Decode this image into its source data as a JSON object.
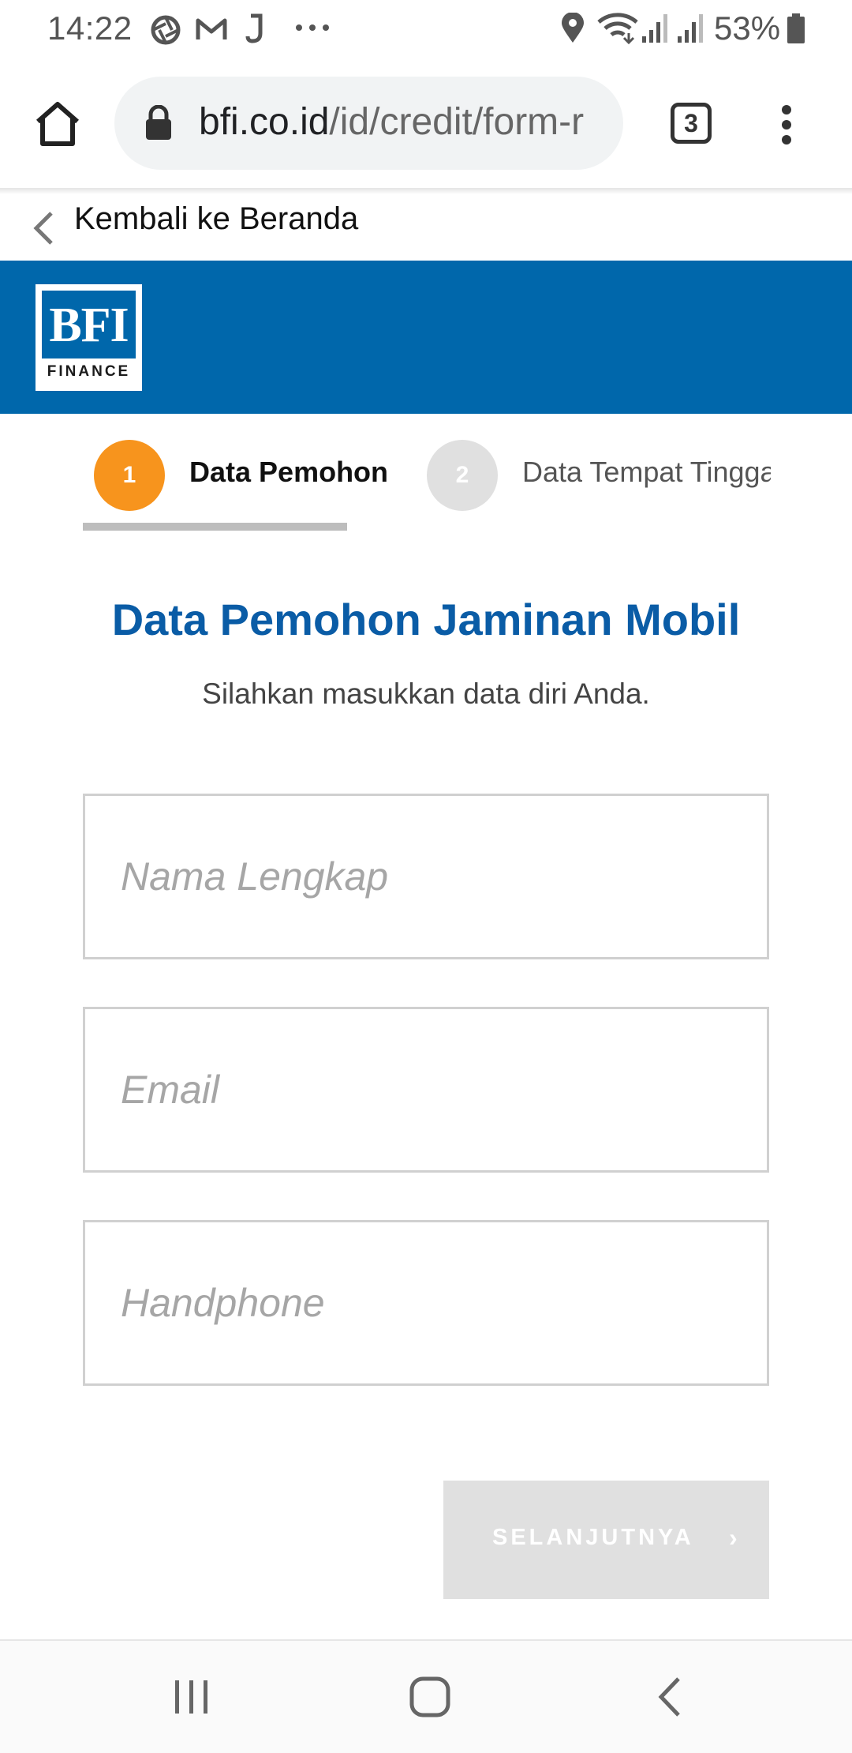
{
  "status_bar": {
    "time": "14:22",
    "battery": "53%",
    "icons": [
      "aperture-icon",
      "gmail-icon",
      "j-app-icon",
      "more-dots-icon",
      "location-icon",
      "wifi-icon",
      "signal-icon",
      "signal-icon",
      "battery-icon"
    ]
  },
  "browser": {
    "url_domain": "bfi.co.id",
    "url_path": "/id/credit/form-r",
    "tab_count": "3"
  },
  "back_link": {
    "label": "Kembali ke Beranda"
  },
  "brand": {
    "logo_text": "BFI",
    "logo_subtext": "FINANCE",
    "header_color": "#0067ab"
  },
  "stepper": {
    "steps": [
      {
        "number": "1",
        "label": "Data Pemohon",
        "active": true,
        "color": "#f7941d"
      },
      {
        "number": "2",
        "label": "Data Tempat Tinggal",
        "active": false,
        "color": "#e0e0e0"
      }
    ]
  },
  "form": {
    "title": "Data Pemohon Jaminan Mobil",
    "subtitle": "Silahkan masukkan data diri Anda.",
    "fields": [
      {
        "placeholder": "Nama Lengkap",
        "value": ""
      },
      {
        "placeholder": "Email",
        "value": ""
      },
      {
        "placeholder": "Handphone",
        "value": ""
      }
    ],
    "next_button": "SELANJUTNYA",
    "next_chevron": "›"
  },
  "colors": {
    "title": "#0a5ca6",
    "accent": "#f7941d",
    "disabled_button": "#e0e0e0"
  }
}
